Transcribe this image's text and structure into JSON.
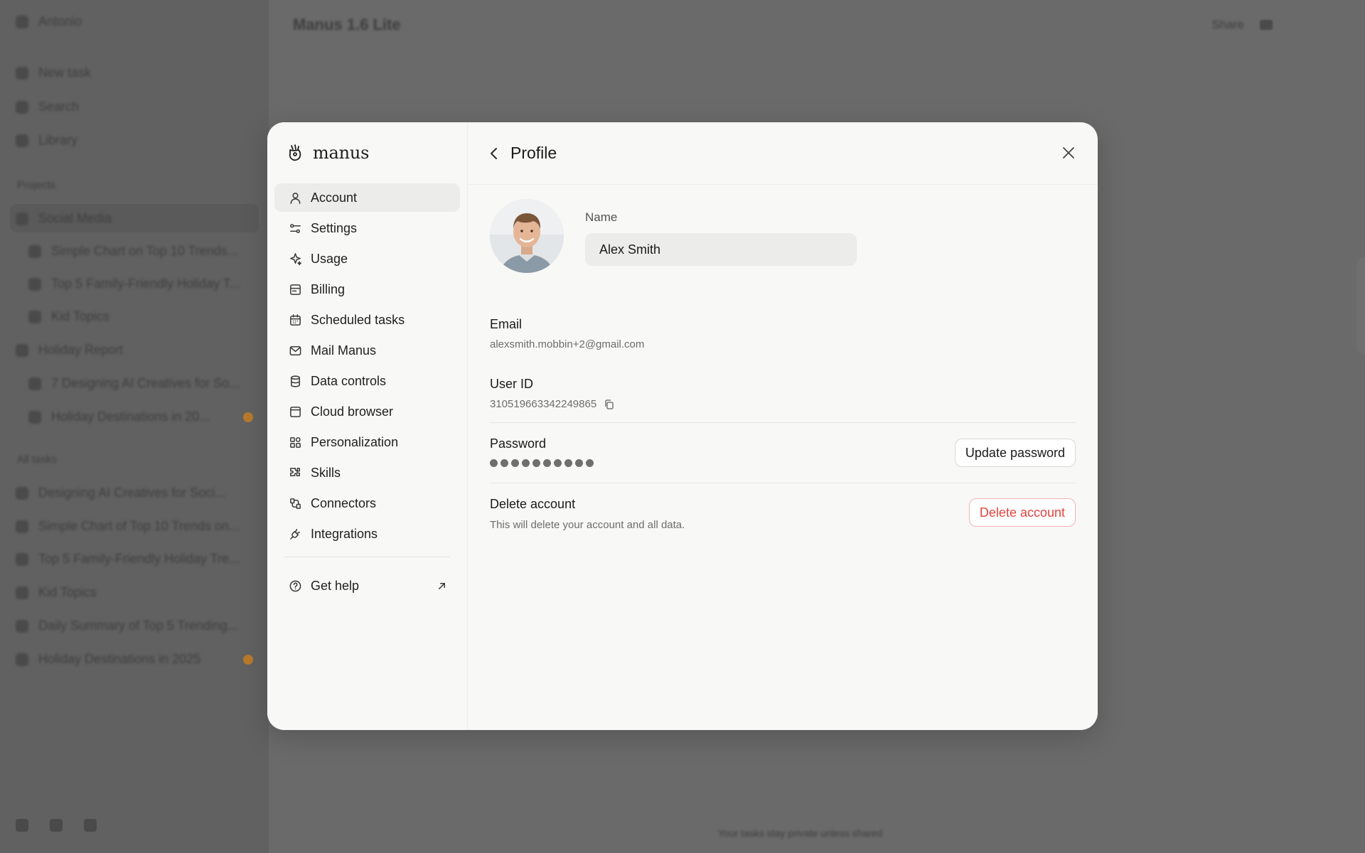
{
  "background": {
    "workspace": "Antonio",
    "nav": [
      "New task",
      "Search",
      "Library"
    ],
    "projects_label": "Projects",
    "projects": [
      {
        "name": "Social Media",
        "children": [
          "Simple Chart on Top 10 Trends...",
          "Top 5 Family-Friendly Holiday T...",
          "Kid Topics"
        ]
      },
      {
        "name": "Holiday Report",
        "children": [
          "7 Designing AI Creatives for So...",
          "Holiday Destinations in 20..."
        ]
      }
    ],
    "tasks_label": "All tasks",
    "tasks": [
      "Designing AI Creatives for Soci...",
      "Simple Chart of Top 10 Trends on...",
      "Top 5 Family-Friendly Holiday Tre...",
      "Kid Topics",
      "Daily Summary of Top 5 Trending...",
      "Holiday Destinations in 2025"
    ],
    "title": "Manus 1.6 Lite",
    "share": "Share",
    "footer": "Your tasks stay private unless shared"
  },
  "modal": {
    "brand": "manus",
    "nav": [
      {
        "label": "Account",
        "icon": "user-icon",
        "active": true
      },
      {
        "label": "Settings",
        "icon": "sliders-icon"
      },
      {
        "label": "Usage",
        "icon": "sparkle-icon"
      },
      {
        "label": "Billing",
        "icon": "billing-icon"
      },
      {
        "label": "Scheduled tasks",
        "icon": "calendar-icon"
      },
      {
        "label": "Mail Manus",
        "icon": "mail-icon"
      },
      {
        "label": "Data controls",
        "icon": "database-icon"
      },
      {
        "label": "Cloud browser",
        "icon": "browser-icon"
      },
      {
        "label": "Personalization",
        "icon": "grid-icon"
      },
      {
        "label": "Skills",
        "icon": "puzzle-icon"
      },
      {
        "label": "Connectors",
        "icon": "connector-icon"
      },
      {
        "label": "Integrations",
        "icon": "plug-icon"
      }
    ],
    "help": "Get help",
    "title": "Profile",
    "name_label": "Name",
    "name_value": "Alex Smith",
    "email_label": "Email",
    "email_value": "alexsmith.mobbin+2@gmail.com",
    "userid_label": "User ID",
    "userid_value": "310519663342249865",
    "password_label": "Password",
    "password_mask_count": 10,
    "update_password": "Update password",
    "delete_label": "Delete account",
    "delete_desc": "This will delete your account and all data.",
    "delete_button": "Delete account",
    "colors": {
      "accent_danger": "#e2453f",
      "active_bg": "#ececea",
      "overlay": "#6b6b6b"
    }
  }
}
